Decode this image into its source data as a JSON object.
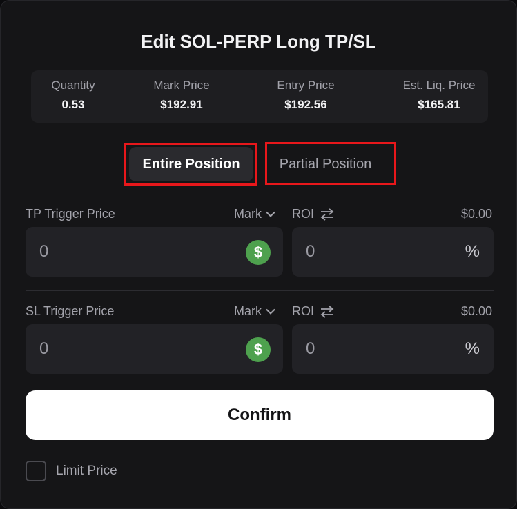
{
  "modal": {
    "title": "Edit SOL-PERP Long TP/SL"
  },
  "stats": [
    {
      "label": "Quantity",
      "value": "0.53"
    },
    {
      "label": "Mark Price",
      "value": "$192.91"
    },
    {
      "label": "Entry Price",
      "value": "$192.56"
    },
    {
      "label": "Est. Liq. Price",
      "value": "$165.81"
    }
  ],
  "tabs": [
    {
      "label": "Entire Position",
      "active": true
    },
    {
      "label": "Partial Position",
      "active": false
    }
  ],
  "take_profit": {
    "label": "TP Trigger Price",
    "price_type": "Mark",
    "roi_label": "ROI",
    "usd_value": "$0.00",
    "price_placeholder": "0",
    "roi_placeholder": "0",
    "currency_symbol": "$",
    "percent_symbol": "%"
  },
  "stop_loss": {
    "label": "SL Trigger Price",
    "price_type": "Mark",
    "roi_label": "ROI",
    "usd_value": "$0.00",
    "price_placeholder": "0",
    "roi_placeholder": "0",
    "currency_symbol": "$",
    "percent_symbol": "%"
  },
  "confirm_label": "Confirm",
  "limit_price_label": "Limit Price",
  "limit_price_checked": false,
  "icons": {
    "price_type_caret": "chevron-down-icon",
    "roi_toggle": "swap-arrows-icon",
    "currency": "dollar-coin-icon"
  },
  "colors": {
    "background": "#151517",
    "accent_green": "#4ea14e",
    "highlight_red": "#e8171b",
    "confirm_bg": "#ffffff"
  }
}
